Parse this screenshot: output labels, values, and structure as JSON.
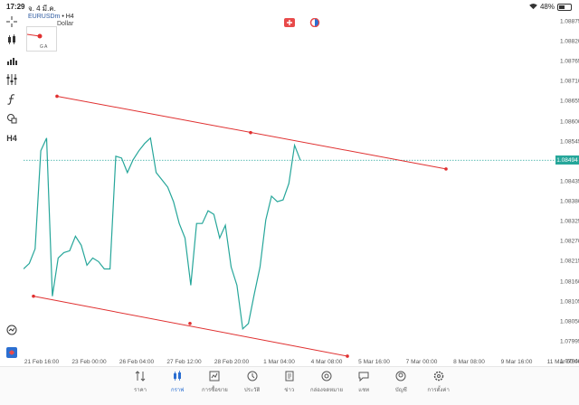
{
  "status_bar": {
    "time": "17:29",
    "date": "จ. 4 มี.ค.",
    "battery_text": "48%",
    "battery_level": 0.48
  },
  "chart_header": {
    "symbol": "EURUSDm",
    "separator": "•",
    "timeframe": "H4",
    "description": "Dollar",
    "mini_label": "G A"
  },
  "toolbar": {
    "timeframe_label": "H4",
    "items": [
      "crosshair-icon",
      "candles-icon",
      "bar-chart-icon",
      "indicator-sliders-icon",
      "function-icon",
      "shapes-icon",
      "timeframe-h4",
      "trading-icon",
      "one-click-icon"
    ]
  },
  "price_axis": {
    "ticks": [
      "1.08875",
      "1.08820",
      "1.08765",
      "1.08710",
      "1.08655",
      "1.08600",
      "1.08545",
      "1.08490",
      "1.08435",
      "1.08380",
      "1.08325",
      "1.08270",
      "1.08215",
      "1.08160",
      "1.08105",
      "1.08050",
      "1.07995",
      "1.07940"
    ],
    "current_price": "1.08494",
    "range": [
      1.0794,
      1.0888
    ]
  },
  "time_axis": {
    "ticks": [
      "21 Feb 16:00",
      "23 Feb 00:00",
      "26 Feb 04:00",
      "27 Feb 12:00",
      "28 Feb 20:00",
      "1 Mar 04:00",
      "4 Mar 08:00",
      "5 Mar 16:00",
      "7 Mar 00:00",
      "8 Mar 08:00",
      "9 Mar 16:00",
      "11 Mar 00:00"
    ]
  },
  "colors": {
    "price_line": "#26a69a",
    "trend_line": "#e03030",
    "current_price_bg": "#26a69a",
    "active_nav": "#2c6fd1"
  },
  "chart_data": {
    "type": "line",
    "series": [
      {
        "name": "EURUSDm",
        "values": [
          1.08195,
          1.0821,
          1.0825,
          1.0852,
          1.08555,
          1.0812,
          1.08225,
          1.0824,
          1.08245,
          1.08285,
          1.0826,
          1.08205,
          1.08225,
          1.08215,
          1.08195,
          1.08195,
          1.08505,
          1.085,
          1.0846,
          1.08495,
          1.0852,
          1.0854,
          1.08555,
          1.0846,
          1.0844,
          1.0842,
          1.0838,
          1.0832,
          1.0828,
          1.0815,
          1.0832,
          1.0832,
          1.08355,
          1.08345,
          1.0828,
          1.08315,
          1.082,
          1.0815,
          1.0803,
          1.08045,
          1.08125,
          1.082,
          1.0833,
          1.08395,
          1.0838,
          1.08385,
          1.0843,
          1.08535,
          1.08494
        ]
      }
    ],
    "trend_lines": [
      {
        "name": "upper",
        "start": 1.0867,
        "mid": 1.0857,
        "end": 1.0847
      },
      {
        "name": "lower",
        "start": 1.0812,
        "mid": 1.08045,
        "end": 1.07955
      }
    ]
  },
  "bottom_nav": [
    {
      "label": "ราคา",
      "icon": "quotes-icon",
      "active": false
    },
    {
      "label": "กราฟ",
      "icon": "chart-icon",
      "active": true
    },
    {
      "label": "การซื้อขาย",
      "icon": "trade-icon",
      "active": false
    },
    {
      "label": "ประวัติ",
      "icon": "history-icon",
      "active": false
    },
    {
      "label": "ข่าว",
      "icon": "news-icon",
      "active": false
    },
    {
      "label": "กล่องจดหมาย",
      "icon": "mailbox-icon",
      "active": false
    },
    {
      "label": "แชท",
      "icon": "chat-icon",
      "active": false
    },
    {
      "label": "บัญชี",
      "icon": "account-icon",
      "active": false
    },
    {
      "label": "การตั้งค่า",
      "icon": "settings-icon",
      "active": false
    }
  ]
}
